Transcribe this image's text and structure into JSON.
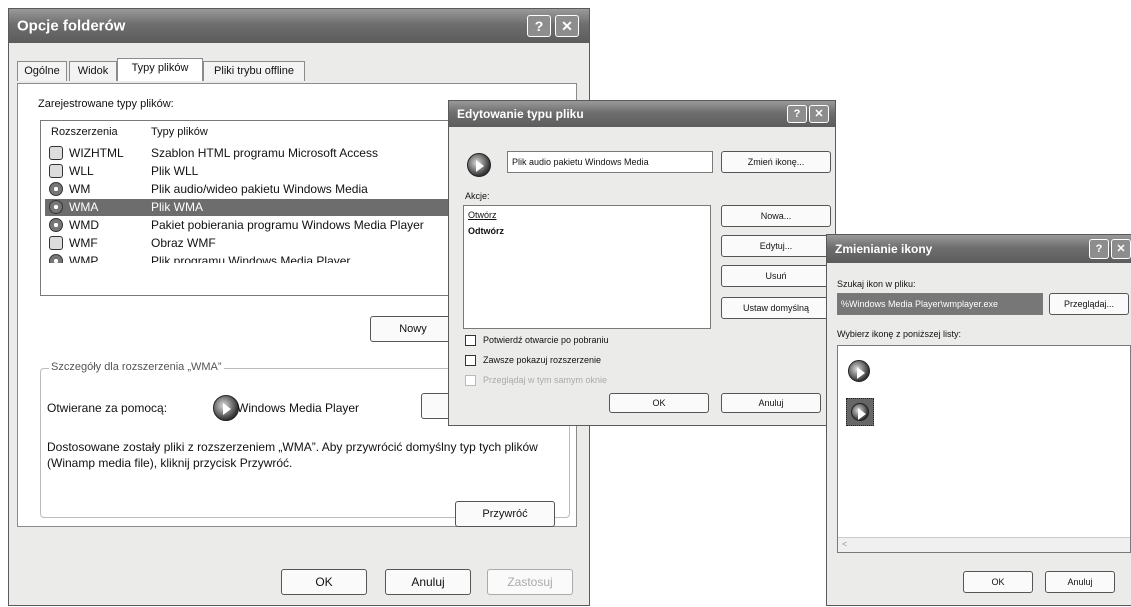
{
  "dialog_folder_options": {
    "title": "Opcje folderów",
    "tabs": [
      "Ogólne",
      "Widok",
      "Typy plików",
      "Pliki trybu offline"
    ],
    "registered_label": "Zarejestrowane typy plików:",
    "columns": [
      "Rozszerzenia",
      "Typy plików"
    ],
    "rows": [
      {
        "ext": "WIZHTML",
        "type": "Szablon HTML programu Microsoft Access",
        "icon": "html-file-icon"
      },
      {
        "ext": "WLL",
        "type": "Plik WLL",
        "icon": "file-icon"
      },
      {
        "ext": "WM",
        "type": "Plik audio/wideo pakietu Windows Media",
        "icon": "media-icon"
      },
      {
        "ext": "WMA",
        "type": "Plik WMA",
        "icon": "media-icon"
      },
      {
        "ext": "WMD",
        "type": "Pakiet pobierania programu Windows Media Player",
        "icon": "media-icon"
      },
      {
        "ext": "WMF",
        "type": "Obraz WMF",
        "icon": "image-icon"
      },
      {
        "ext": "WMP",
        "type": "Plik programu Windows Media Player",
        "icon": "media-icon"
      }
    ],
    "selected_row": 3,
    "new_button": "Nowy",
    "details_group": "Szczegóły dla rozszerzenia „WMA”",
    "opens_with_label": "Otwierane za pomocą:",
    "opens_with_app": "Windows Media Player",
    "description": "Dostosowane zostały pliki z rozszerzeniem „WMA”. Aby przywrócić domyślny typ tych plików (Winamp media file), kliknij przycisk Przywróć.",
    "restore_button": "Przywróć",
    "ok": "OK",
    "cancel": "Anuluj",
    "apply": "Zastosuj",
    "help_glyph": "?",
    "close_glyph": "✕"
  },
  "dialog_edit_type": {
    "title": "Edytowanie typu pliku",
    "name_value": "Plik audio pakietu Windows Media",
    "change_icon_button": "Zmień ikonę...",
    "actions_label": "Akcje:",
    "actions": [
      "Otwórz",
      "Odtwórz"
    ],
    "new_button": "Nowa...",
    "edit_button": "Edytuj...",
    "delete_button": "Usuń",
    "default_button": "Ustaw domyślną",
    "confirm_open": "Potwierdź otwarcie po pobraniu",
    "always_show_ext": "Zawsze pokazuj rozszerzenie",
    "browse_same_window": "Przeglądaj w tym samym oknie",
    "ok": "OK",
    "cancel": "Anuluj"
  },
  "dialog_change_icon": {
    "title": "Zmienianie ikony",
    "search_label": "Szukaj ikon w pliku:",
    "path_value": "%Windows Media Player\\wmplayer.exe",
    "browse_button": "Przeglądaj...",
    "choose_label": "Wybierz ikonę z poniższej listy:",
    "ok": "OK",
    "cancel": "Anuluj"
  }
}
